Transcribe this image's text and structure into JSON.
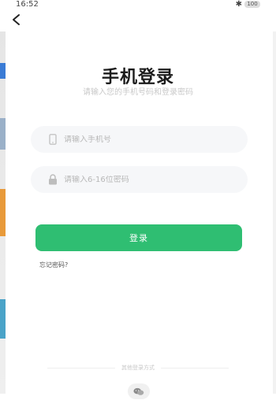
{
  "status_bar": {
    "time": "16:52",
    "battery": "100"
  },
  "header": {
    "title": "手机登录",
    "subtitle": "请输入您的手机号码和登录密码"
  },
  "form": {
    "phone_placeholder": "请输入手机号",
    "password_placeholder": "请输入6-16位密码",
    "login_label": "登录",
    "forgot_label": "忘记密码?"
  },
  "other_login": {
    "label": "其他登录方式"
  },
  "colors": {
    "accent": "#2fbe72",
    "field_bg": "#f6f7f9"
  }
}
